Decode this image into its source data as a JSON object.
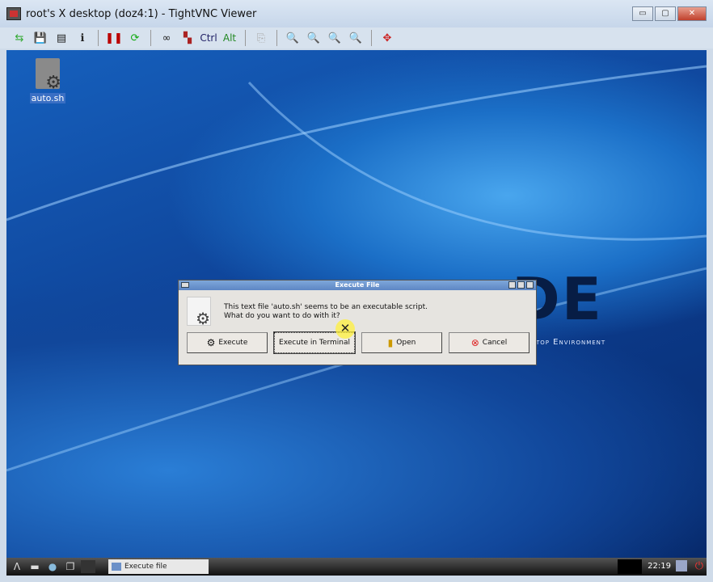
{
  "window": {
    "title": "root's X desktop (doz4:1) - TightVNC Viewer",
    "minimize": "▭",
    "maximize": "▢",
    "close": "✕"
  },
  "toolbar": {
    "ctrl_label": "Ctrl",
    "alt_label": "Alt"
  },
  "desktop": {
    "icon_label": "auto.sh",
    "logo_text": "DE",
    "logo_subtext": "top Environment"
  },
  "dialog": {
    "title": "Execute File",
    "message_line1": "This text file 'auto.sh' seems to be an executable script.",
    "message_line2": "What do you want to do with it?",
    "buttons": {
      "execute": "Execute",
      "execute_terminal": "Execute in Terminal",
      "open": "Open",
      "cancel": "Cancel"
    }
  },
  "taskbar": {
    "task_label": "Execute file",
    "clock": "22:19"
  }
}
